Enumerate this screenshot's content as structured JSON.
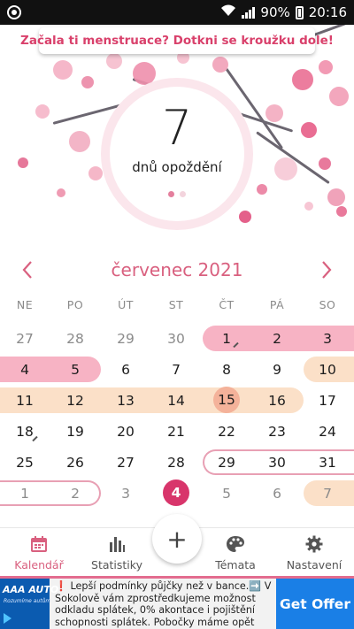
{
  "status_bar": {
    "battery": "90%",
    "time": "20:16",
    "app_icon": "opera-icon"
  },
  "banner": {
    "text": "Začala ti menstruace? Dotkni se kroužku dole!"
  },
  "delay": {
    "number": "7",
    "label": "dnů opoždění"
  },
  "month": {
    "title": "červenec 2021"
  },
  "weekdays": [
    "NE",
    "PO",
    "ÚT",
    "ST",
    "ČT",
    "PÁ",
    "SO"
  ],
  "weeks": [
    [
      "27",
      "28",
      "29",
      "30",
      "1",
      "2",
      "3"
    ],
    [
      "4",
      "5",
      "6",
      "7",
      "8",
      "9",
      "10"
    ],
    [
      "11",
      "12",
      "13",
      "14",
      "15",
      "16",
      "17"
    ],
    [
      "18",
      "19",
      "20",
      "21",
      "22",
      "23",
      "24"
    ],
    [
      "25",
      "26",
      "27",
      "28",
      "29",
      "30",
      "31"
    ],
    [
      "1",
      "2",
      "3",
      "4",
      "5",
      "6",
      "7"
    ]
  ],
  "nav": [
    {
      "label": "Kalendář",
      "icon": "calendar-icon",
      "active": true
    },
    {
      "label": "Statistiky",
      "icon": "bar-chart-icon",
      "active": false
    },
    {
      "label": "Témata",
      "icon": "palette-icon",
      "active": false
    },
    {
      "label": "Nastavení",
      "icon": "gear-icon",
      "active": false
    }
  ],
  "fab": {
    "label": "+"
  },
  "ad": {
    "logo": "AAA AUTO",
    "tagline": "Rozumíme autům",
    "text": "❗ Lepší podmínky půjčky než v bance.➡️ V Sokolově vám zprostředkujeme možnost odkladu splátek, 0% akontace i pojištění schopnosti splátek. Pobočky máme opět otevřené a těšíme",
    "button": "Get Offer"
  },
  "colors": {
    "accent": "#d9607f",
    "period_band": "#f7b3c4",
    "fertile_band": "#fbe0c8",
    "today": "#d8356b",
    "predicted_outline": "#e8a0b4"
  }
}
